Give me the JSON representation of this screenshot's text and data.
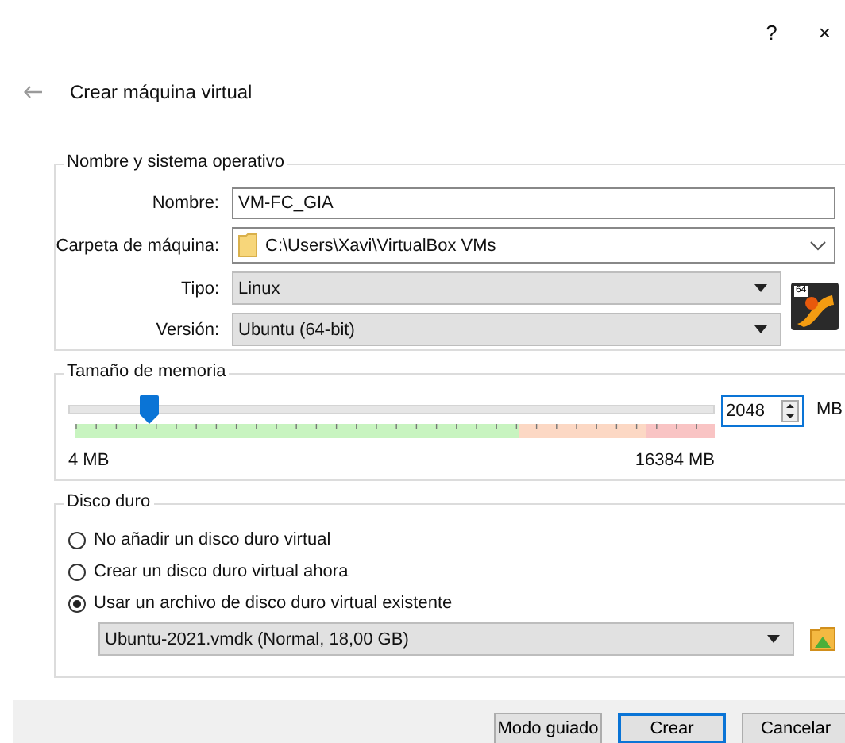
{
  "window": {
    "title": "Crear máquina virtual",
    "help": "?",
    "close": "×"
  },
  "name_group": {
    "title": "Nombre y sistema operativo",
    "rows": [
      {
        "kind": "text",
        "label": "Nombre:",
        "value": "VM-FC_GIA"
      },
      {
        "kind": "folder",
        "label": "Carpeta de máquina:",
        "value": "C:\\Users\\Xavi\\VirtualBox VMs"
      },
      {
        "kind": "select",
        "label": "Tipo:",
        "value": "Linux"
      },
      {
        "kind": "select",
        "label": "Versión:",
        "value": "Ubuntu (64-bit)"
      }
    ],
    "os_badge": "64"
  },
  "memory": {
    "title": "Tamaño de memoria",
    "level": 0.125,
    "value": "2048",
    "unit": "MB",
    "min_label": "4 MB",
    "max_label": "16384 MB"
  },
  "disk": {
    "title": "Disco duro",
    "options": [
      {
        "label": "No añadir un disco duro virtual",
        "selected": false
      },
      {
        "label": "Crear un disco duro virtual ahora",
        "selected": false
      },
      {
        "label": "Usar un archivo de disco duro virtual existente",
        "selected": true
      }
    ],
    "file": "Ubuntu-2021.vmdk (Normal, 18,00 GB)"
  },
  "buttons": [
    {
      "label": "Modo guiado",
      "default": false
    },
    {
      "label": "Crear",
      "default": true
    },
    {
      "label": "Cancelar",
      "default": false
    }
  ]
}
